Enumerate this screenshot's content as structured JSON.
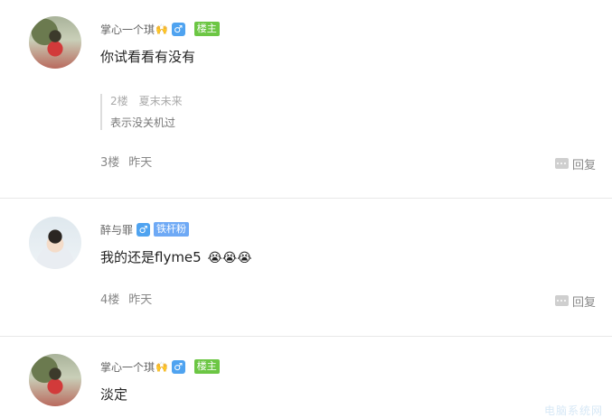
{
  "posts": [
    {
      "username": "掌心一个琪",
      "username_emoji": "🙌",
      "gender": "♂",
      "badge": "楼主",
      "content": "你试看看有没有",
      "quote": {
        "floor": "2楼",
        "user": "夏末未来",
        "text": "表示没关机过"
      },
      "floor": "3楼",
      "time": "昨天",
      "reply_label": "回复"
    },
    {
      "username": "醉与罪",
      "gender": "♂",
      "badge": "铁杆粉",
      "content": "我的还是flyme5",
      "content_emojis": [
        "😭",
        "😭",
        "😭"
      ],
      "floor": "4楼",
      "time": "昨天",
      "reply_label": "回复"
    },
    {
      "username": "掌心一个琪",
      "username_emoji": "🙌",
      "gender": "♂",
      "badge": "楼主",
      "content": "淡定"
    }
  ],
  "watermark": "电脑系统网",
  "colors": {
    "owner_badge": "#6cc644",
    "fan_badge": "#6ea9f5",
    "gender": "#4fa3f0"
  }
}
